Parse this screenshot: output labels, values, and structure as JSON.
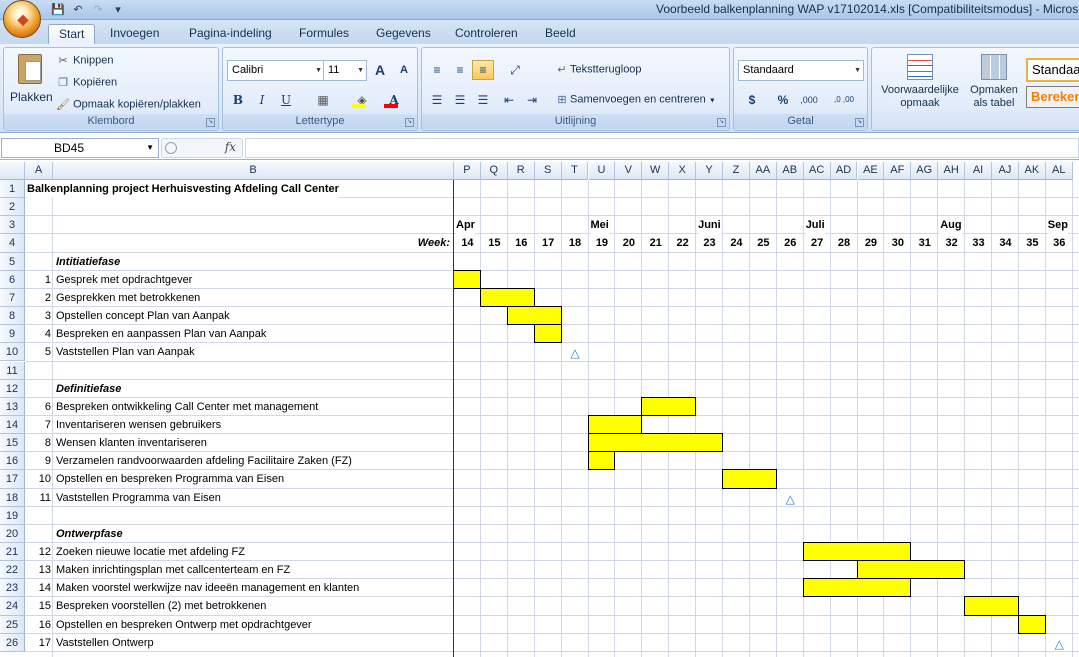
{
  "window": {
    "title": "Voorbeeld balkenplanning WAP v17102014.xls  [Compatibiliteitsmodus] - Micros"
  },
  "qat": {
    "save": "💾",
    "undo": "↶",
    "redo": "↷",
    "more": "▾"
  },
  "tabs": [
    "Start",
    "Invoegen",
    "Pagina-indeling",
    "Formules",
    "Gegevens",
    "Controleren",
    "Beeld"
  ],
  "clipboard": {
    "paste": "Plakken",
    "cut": "Knippen",
    "copy": "Kopiëren",
    "format_painter": "Opmaak kopiëren/plakken",
    "label": "Klembord"
  },
  "font": {
    "name": "Calibri",
    "size": "11",
    "label": "Lettertype",
    "bold": "B",
    "italic": "I",
    "underline": "U",
    "grow": "A",
    "shrink": "A",
    "fill_color": "#ffff00",
    "font_color": "#ff0000"
  },
  "alignment": {
    "wrap": "Tekstterugloop",
    "merge": "Samenvoegen en centreren",
    "label": "Uitlijning"
  },
  "number": {
    "format": "Standaard",
    "currency": "$",
    "percent": "%",
    "thousands": ",000",
    "dec_inc": ",0 ,00",
    "label": "Getal"
  },
  "styles": {
    "conditional": "Voorwaardelijke opmaak",
    "as_table": "Opmaken als tabel",
    "style_normal": "Standaa",
    "style_calc": "Bereken"
  },
  "formula_bar": {
    "name_box": "BD45",
    "fx": "fx",
    "content": ""
  },
  "columns": [
    "A",
    "B",
    "P",
    "Q",
    "R",
    "S",
    "T",
    "U",
    "V",
    "W",
    "X",
    "Y",
    "Z",
    "AA",
    "AB",
    "AC",
    "AD",
    "AE",
    "AF",
    "AG",
    "AH",
    "AI",
    "AJ",
    "AK",
    "AL"
  ],
  "title_cell": "Balkenplanning project Herhuisvesting Afdeling Call Center",
  "months": [
    {
      "col": 0,
      "label": "Apr"
    },
    {
      "col": 5,
      "label": "Mei"
    },
    {
      "col": 9,
      "label": "Juni"
    },
    {
      "col": 13,
      "label": "Juli"
    },
    {
      "col": 18,
      "label": "Aug"
    },
    {
      "col": 22,
      "label": "Sep"
    }
  ],
  "week_label": "Week:",
  "weeks": [
    "14",
    "15",
    "16",
    "17",
    "18",
    "19",
    "20",
    "21",
    "22",
    "23",
    "24",
    "25",
    "26",
    "27",
    "28",
    "29",
    "30",
    "31",
    "32",
    "33",
    "34",
    "35",
    "36"
  ],
  "rows": [
    {
      "n": "5",
      "a": "",
      "b": "Intitiatiefase",
      "phase": true
    },
    {
      "n": "6",
      "a": "1",
      "b": "Gesprek met opdrachtgever",
      "start": 0,
      "end": 0
    },
    {
      "n": "7",
      "a": "2",
      "b": "Gesprekken met betrokkenen",
      "start": 1,
      "end": 2
    },
    {
      "n": "8",
      "a": "3",
      "b": "Opstellen concept Plan van Aanpak",
      "start": 2,
      "end": 3
    },
    {
      "n": "9",
      "a": "4",
      "b": "Bespreken en aanpassen Plan van Aanpak",
      "start": 3,
      "end": 3
    },
    {
      "n": "10",
      "a": "5",
      "b": "Vaststellen Plan van Aanpak",
      "milestone": 4
    },
    {
      "n": "11",
      "a": "",
      "b": ""
    },
    {
      "n": "12",
      "a": "",
      "b": "Definitiefase",
      "phase": true
    },
    {
      "n": "13",
      "a": "6",
      "b": "Bespreken ontwikkeling Call Center met management",
      "start": 7,
      "end": 8
    },
    {
      "n": "14",
      "a": "7",
      "b": "Inventariseren wensen gebruikers",
      "start": 5,
      "end": 6
    },
    {
      "n": "15",
      "a": "8",
      "b": "Wensen klanten inventariseren",
      "start": 5,
      "end": 9
    },
    {
      "n": "16",
      "a": "9",
      "b": "Verzamelen randvoorwaarden afdeling Facilitaire Zaken (FZ)",
      "start": 5,
      "end": 5
    },
    {
      "n": "17",
      "a": "10",
      "b": "Opstellen en bespreken Programma van Eisen",
      "start": 10,
      "end": 11
    },
    {
      "n": "18",
      "a": "11",
      "b": "Vaststellen Programma van Eisen",
      "milestone": 12
    },
    {
      "n": "19",
      "a": "",
      "b": ""
    },
    {
      "n": "20",
      "a": "",
      "b": "Ontwerpfase",
      "phase": true
    },
    {
      "n": "21",
      "a": "12",
      "b": "Zoeken nieuwe locatie met afdeling FZ",
      "start": 13,
      "end": 16
    },
    {
      "n": "22",
      "a": "13",
      "b": "Maken inrichtingsplan met callcenterteam en FZ",
      "start": 15,
      "end": 18
    },
    {
      "n": "23",
      "a": "14",
      "b": "Maken voorstel werkwijze nav ideeën management en klanten",
      "start": 13,
      "end": 16
    },
    {
      "n": "24",
      "a": "15",
      "b": "Bespreken voorstellen (2) met betrokkenen",
      "start": 19,
      "end": 20
    },
    {
      "n": "25",
      "a": "16",
      "b": "Opstellen en bespreken Ontwerp met opdrachtgever",
      "start": 21,
      "end": 21
    },
    {
      "n": "26",
      "a": "17",
      "b": "Vaststellen Ontwerp",
      "milestone": 22
    }
  ],
  "milestone_symbol": "△"
}
